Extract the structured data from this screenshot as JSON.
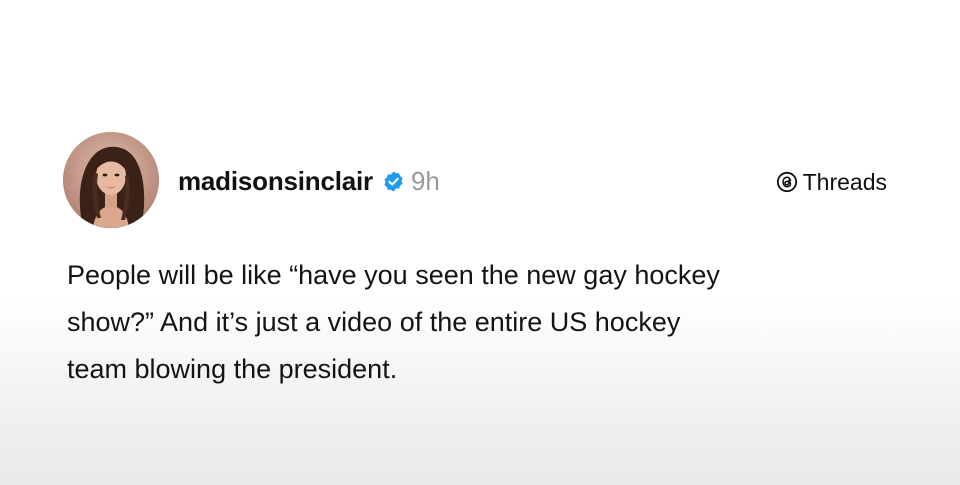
{
  "post": {
    "username": "madisonsinclair",
    "verified_icon": "verified-badge-icon",
    "timestamp": "9h",
    "platform_label": "Threads",
    "platform_icon": "threads-logo-icon",
    "text_lines": [
      "People will be like “have you seen the new gay hockey",
      "show?” And it’s just a video of the entire US hockey",
      "team blowing the president."
    ]
  },
  "colors": {
    "verified_badge": "#1d9bf0",
    "timestamp": "#999999",
    "text": "#141414"
  }
}
